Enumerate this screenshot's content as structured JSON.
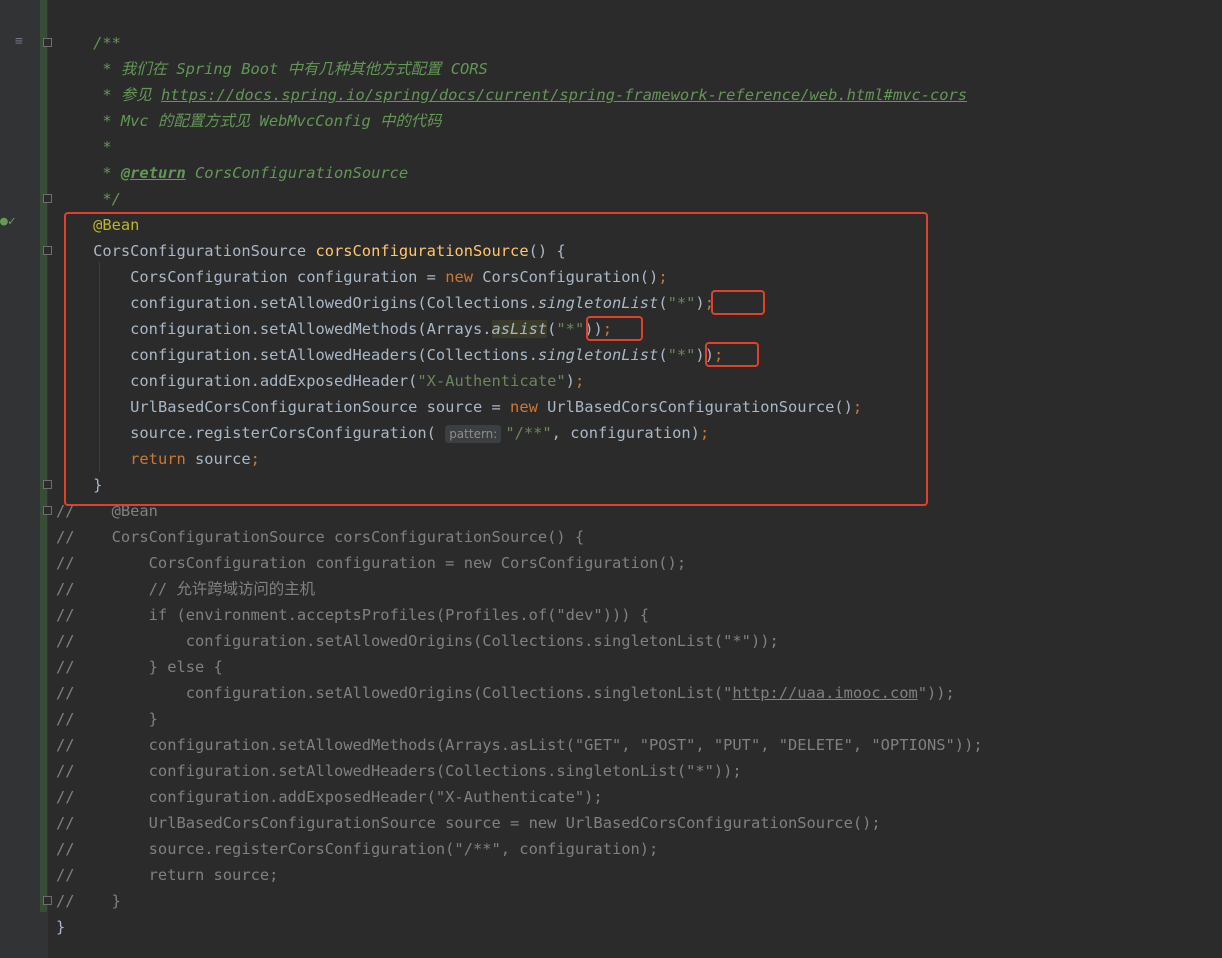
{
  "editor": {
    "doc_open": "/**",
    "doc1_prefix": " * ",
    "doc1_text": "我们在 Spring Boot 中有几种其他方式配置 CORS",
    "doc2_prefix": " * 参见 ",
    "doc2_link": "https://docs.spring.io/spring/docs/current/spring-framework-reference/web.html#mvc-cors",
    "doc3_text": " * Mvc 的配置方式见 WebMvcConfig 中的代码",
    "doc4_text": " *",
    "doc5_prefix": " * ",
    "doc5_tag": "@return",
    "doc5_text": " CorsConfigurationSource",
    "doc_close": " */",
    "annotation": "@Bean",
    "method_type": "CorsConfigurationSource ",
    "method_name": "corsConfigurationSource",
    "method_sig_end": "() {",
    "l1_a": "    CorsConfiguration configuration = ",
    "l1_kw": "new",
    "l1_b": " CorsConfiguration()",
    "l1_semi": ";",
    "l2_a": "    configuration.setAllowedOrigins(Collections.",
    "l2_fn": "singletonList",
    "l2_str": "\"*\"",
    "l2_end": ")",
    "l2_semi": ");",
    "l3_a": "    configuration.setAllowedMethods(Arrays.",
    "l3_fn": "asList",
    "l3_str": "\"*\"",
    "l3_end": ")",
    "l3_semi": ";",
    "l4_a": "    configuration.setAllowedHeaders(Collections.",
    "l4_fn": "singletonList",
    "l4_str": "\"*\"",
    "l4_end": ")",
    "l4_semi": ");",
    "l5_a": "    configuration.addExposedHeader(",
    "l5_str": "\"X-Authenticate\"",
    "l5_end": ")",
    "l5_semi": ";",
    "l6_a": "    UrlBasedCorsConfigurationSource source = ",
    "l6_kw": "new",
    "l6_b": " UrlBasedCorsConfigurationSource()",
    "l6_semi": ";",
    "l7_a": "    source.registerCorsConfiguration( ",
    "l7_hint": "pattern:",
    "l7_str": "\"/**\"",
    "l7_b": ", configuration)",
    "l7_semi": ";",
    "l8_kw": "    return",
    "l8_b": " source",
    "l8_semi": ";",
    "close_brace": "}",
    "commented": [
      "//    @Bean",
      "//    CorsConfigurationSource corsConfigurationSource() {",
      "//        CorsConfiguration configuration = new CorsConfiguration();",
      "//        // 允许跨域访问的主机",
      "//        if (environment.acceptsProfiles(Profiles.of(\"dev\"))) {",
      "//            configuration.setAllowedOrigins(Collections.singletonList(\"*\"));",
      "//        } else {"
    ],
    "commented_link_prefix": "//            configuration.setAllowedOrigins(Collections.singletonList(\"",
    "commented_link": "http://uaa.imooc.com",
    "commented_link_suffix": "\"));",
    "commented_rest": [
      "//        }",
      "//        configuration.setAllowedMethods(Arrays.asList(\"GET\", \"POST\", \"PUT\", \"DELETE\", \"OPTIONS\"));",
      "//        configuration.setAllowedHeaders(Collections.singletonList(\"*\"));",
      "//        configuration.addExposedHeader(\"X-Authenticate\");",
      "//        UrlBasedCorsConfigurationSource source = new UrlBasedCorsConfigurationSource();",
      "//        source.registerCorsConfiguration(\"/**\", configuration);",
      "//        return source;",
      "//    }"
    ],
    "class_close": "}"
  },
  "colors": {
    "background": "#2b2b2b",
    "highlight_box": "#e0412b",
    "keyword": "#cc7832",
    "string": "#6a8759",
    "doc_comment": "#629755",
    "comment": "#808080",
    "method_name": "#ffc66d",
    "annotation": "#bbb529"
  },
  "icons": {
    "gutter_doc": "reader-mode-icon",
    "gutter_bean": "spring-bean-icon",
    "fold": "fold-marker-icon"
  }
}
